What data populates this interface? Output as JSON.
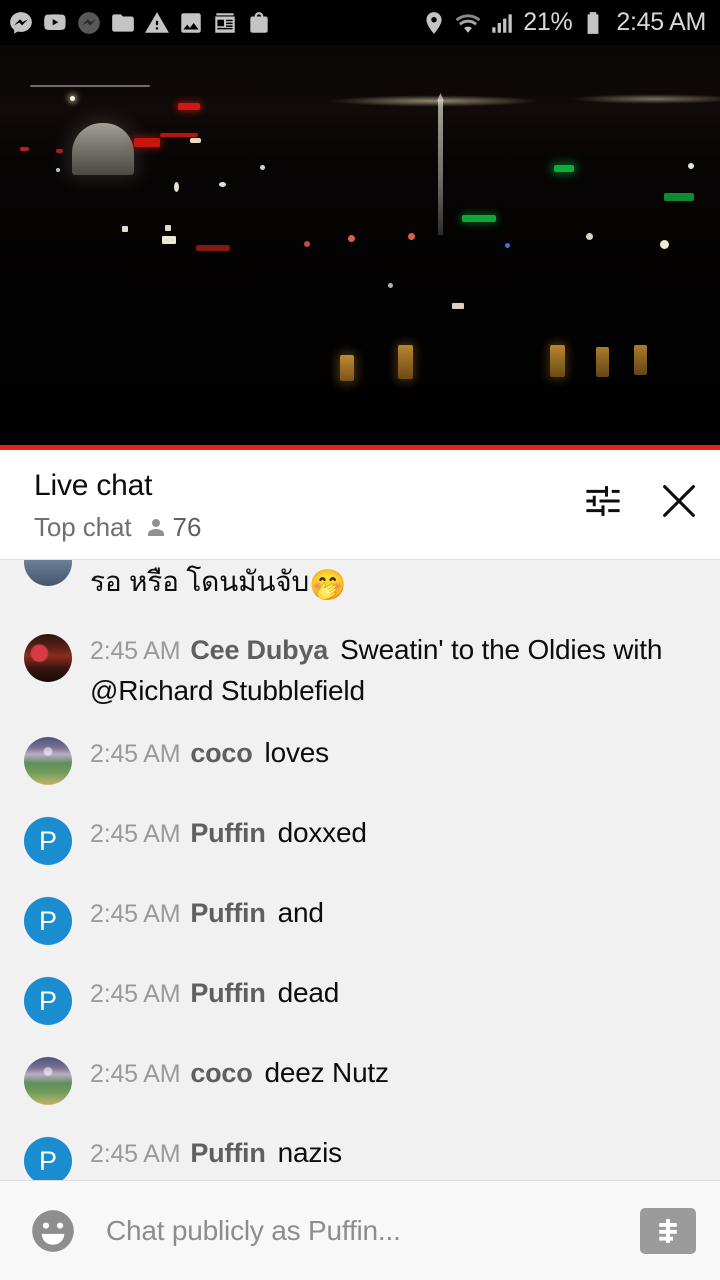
{
  "status_bar": {
    "left_icons": [
      {
        "name": "messenger-icon"
      },
      {
        "name": "youtube-icon"
      },
      {
        "name": "messenger-muted-icon"
      },
      {
        "name": "folder-icon"
      },
      {
        "name": "warning-icon"
      },
      {
        "name": "photo-icon"
      },
      {
        "name": "news-icon"
      },
      {
        "name": "shopping-bag-icon"
      }
    ],
    "location_icon": "location-pin-icon",
    "wifi_icon": "wifi-icon",
    "signal_icon": "cellular-signal-icon",
    "battery_percent": "21%",
    "battery_icon": "battery-icon",
    "time": "2:45 AM"
  },
  "video": {
    "name": "live-stream-video",
    "progress_color": "#e62117",
    "progress_percent": 100
  },
  "chat_header": {
    "title": "Live chat",
    "subtitle": "Top chat",
    "viewer_count": "76",
    "settings_icon": "tune-sliders-icon",
    "close_icon": "close-icon"
  },
  "messages": [
    {
      "avatar_type": "photo-top",
      "avatar_label": "",
      "timestamp": "",
      "author": "",
      "text": "รอ หรือ โดนมันจับ",
      "emoji": "🤭",
      "partial": true
    },
    {
      "avatar_type": "photo-concert",
      "avatar_label": "",
      "timestamp": "2:45 AM",
      "author": "Cee Dubya",
      "text": "Sweatin' to the Oldies with @Richard Stubblefield",
      "emoji": "",
      "partial": false
    },
    {
      "avatar_type": "photo-stadium",
      "avatar_label": "",
      "timestamp": "2:45 AM",
      "author": "coco",
      "text": "loves",
      "emoji": "",
      "partial": false
    },
    {
      "avatar_type": "letter-blue",
      "avatar_label": "P",
      "timestamp": "2:45 AM",
      "author": "Puffin",
      "text": "doxxed",
      "emoji": "",
      "partial": false
    },
    {
      "avatar_type": "letter-blue",
      "avatar_label": "P",
      "timestamp": "2:45 AM",
      "author": "Puffin",
      "text": "and",
      "emoji": "",
      "partial": false
    },
    {
      "avatar_type": "letter-blue",
      "avatar_label": "P",
      "timestamp": "2:45 AM",
      "author": "Puffin",
      "text": "dead",
      "emoji": "",
      "partial": false
    },
    {
      "avatar_type": "photo-stadium",
      "avatar_label": "",
      "timestamp": "2:45 AM",
      "author": "coco",
      "text": "deez Nutz",
      "emoji": "",
      "partial": false
    },
    {
      "avatar_type": "letter-blue",
      "avatar_label": "P",
      "timestamp": "2:45 AM",
      "author": "Puffin",
      "text": "nazis",
      "emoji": "",
      "partial": false
    }
  ],
  "composer": {
    "emoji_icon": "emoji-smiley-icon",
    "placeholder": "Chat publicly as Puffin...",
    "value": "",
    "superchat_icon": "super-chat-dollar-icon"
  },
  "colors": {
    "accent_red": "#e62117",
    "avatar_blue": "#1a8cd0",
    "chat_bg": "#f1f1f1",
    "header_bg": "#ffffff",
    "composer_bg": "#f8f8f8"
  }
}
